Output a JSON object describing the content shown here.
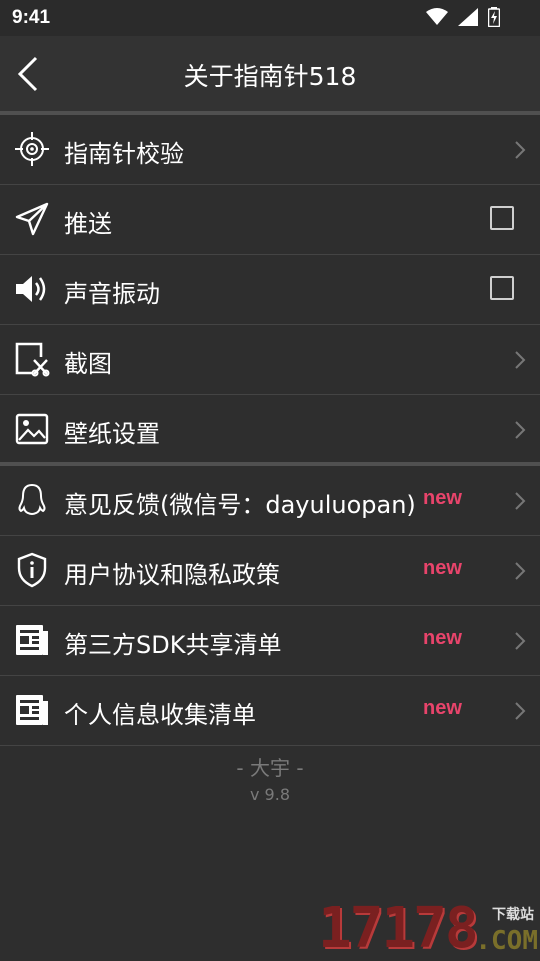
{
  "status": {
    "time": "9:41"
  },
  "appbar": {
    "title": "关于指南针518"
  },
  "rows": [
    {
      "label": "指南针校验",
      "icon": "crosshair-icon",
      "trailing": "chevron"
    },
    {
      "label": "推送",
      "icon": "send-icon",
      "trailing": "checkbox",
      "checked": false
    },
    {
      "label": "声音振动",
      "icon": "volume-icon",
      "trailing": "checkbox",
      "checked": false
    },
    {
      "label": "截图",
      "icon": "screenshot-icon",
      "trailing": "chevron"
    },
    {
      "label": "壁纸设置",
      "icon": "image-icon",
      "trailing": "chevron"
    },
    {
      "label": "意见反馈(微信号：dayuluopan)",
      "icon": "qq-icon",
      "trailing": "chevron",
      "badge": "new"
    },
    {
      "label": "用户协议和隐私政策",
      "icon": "shield-info-icon",
      "trailing": "chevron",
      "badge": "new"
    },
    {
      "label": "第三方SDK共享清单",
      "icon": "document-icon",
      "trailing": "chevron",
      "badge": "new"
    },
    {
      "label": "个人信息收集清单",
      "icon": "document-icon",
      "trailing": "chevron",
      "badge": "new"
    }
  ],
  "footer": {
    "brand": "- 大宇 -",
    "version": "v 9.8"
  },
  "watermark": {
    "number": "17178",
    "download": "下载站",
    "domain": ".COM"
  },
  "colors": {
    "accent_new": "#e8446b",
    "background": "#2e2e2e",
    "appbar": "#333333"
  }
}
